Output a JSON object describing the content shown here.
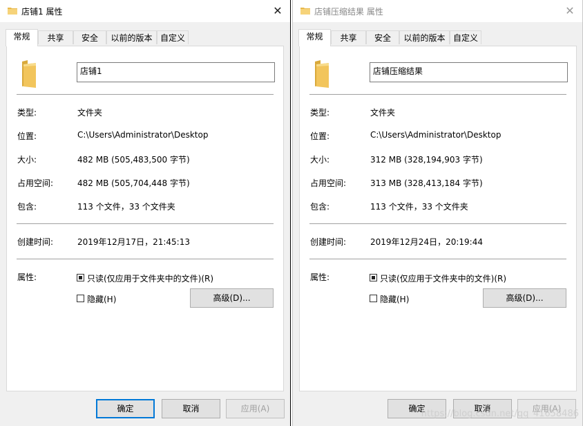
{
  "windows": [
    {
      "title": "店铺1 属性",
      "tabs": [
        "常规",
        "共享",
        "安全",
        "以前的版本",
        "自定义"
      ],
      "name": "店铺1",
      "props": {
        "type_label": "类型:",
        "type_value": "文件夹",
        "location_label": "位置:",
        "location_value": "C:\\Users\\Administrator\\Desktop",
        "size_label": "大小:",
        "size_value": "482 MB (505,483,500 字节)",
        "ondisk_label": "占用空间:",
        "ondisk_value": "482 MB (505,704,448 字节)",
        "contains_label": "包含:",
        "contains_value": "113 个文件，33 个文件夹",
        "created_label": "创建时间:",
        "created_value": "2019年12月17日，21:45:13",
        "attributes_label": "属性:"
      },
      "readonly_label": "只读(仅应用于文件夹中的文件)(R)",
      "hidden_label": "隐藏(H)",
      "advanced_label": "高级(D)...",
      "buttons": {
        "ok": "确定",
        "cancel": "取消",
        "apply": "应用(A)"
      }
    },
    {
      "title": "店铺压缩结果 属性",
      "tabs": [
        "常规",
        "共享",
        "安全",
        "以前的版本",
        "自定义"
      ],
      "name": "店铺压缩结果",
      "props": {
        "type_label": "类型:",
        "type_value": "文件夹",
        "location_label": "位置:",
        "location_value": "C:\\Users\\Administrator\\Desktop",
        "size_label": "大小:",
        "size_value": "312 MB (328,194,903 字节)",
        "ondisk_label": "占用空间:",
        "ondisk_value": "313 MB (328,413,184 字节)",
        "contains_label": "包含:",
        "contains_value": "113 个文件，33 个文件夹",
        "created_label": "创建时间:",
        "created_value": "2019年12月24日，20:19:44",
        "attributes_label": "属性:"
      },
      "readonly_label": "只读(仅应用于文件夹中的文件)(R)",
      "hidden_label": "隐藏(H)",
      "advanced_label": "高级(D)...",
      "buttons": {
        "ok": "确定",
        "cancel": "取消",
        "apply": "应用(A)"
      }
    }
  ],
  "watermark": "https://blog.csdn.net/qq_41658486",
  "colors": {
    "accent": "#0078d7",
    "folder": "#f2c55c"
  },
  "icons": [
    "folder-icon",
    "close-icon"
  ]
}
